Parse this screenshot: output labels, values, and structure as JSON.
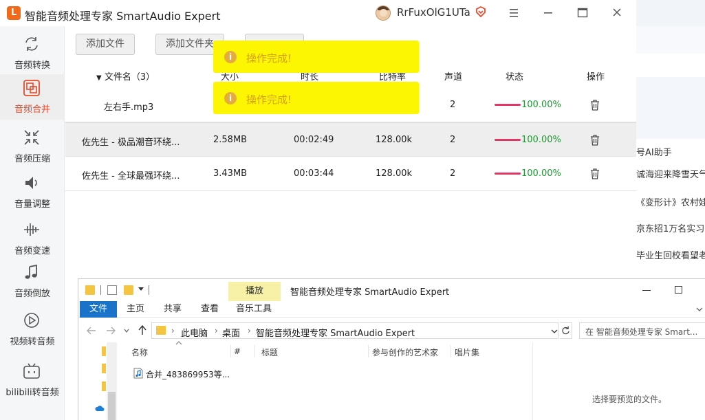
{
  "app": {
    "title": "智能音频处理专家 SmartAudio Expert",
    "logo_text": "L",
    "user_name": "RrFuxOlG1UTa",
    "accent_color": "#e8492a",
    "sidebar": [
      {
        "label": "音频转换",
        "icon": "convert-icon"
      },
      {
        "label": "音频合并",
        "icon": "merge-icon",
        "active": true
      },
      {
        "label": "音频压缩",
        "icon": "compress-icon"
      },
      {
        "label": "音量调整",
        "icon": "volume-icon"
      },
      {
        "label": "音频变速",
        "icon": "speed-icon"
      },
      {
        "label": "音频倒放",
        "icon": "reverse-icon"
      },
      {
        "label": "视频转音频",
        "icon": "video-to-audio-icon"
      },
      {
        "label": "bilibili转音频",
        "icon": "bilibili-icon"
      }
    ],
    "toolbar": {
      "add_file": "添加文件",
      "add_folder": "添加文件夹"
    },
    "table": {
      "headers": {
        "name": "文件名（3）",
        "size": "大小",
        "duration": "时长",
        "bitrate": "比特率",
        "channels": "声道",
        "status": "状态",
        "actions": "操作"
      },
      "rows": [
        {
          "name": "左右手.mp3",
          "size": "",
          "duration": "",
          "bitrate": "",
          "channels": "2",
          "progress": 1.0,
          "percent": "100.00%"
        },
        {
          "name": "佐先生 - 极品潮音环绕...",
          "size": "2.58MB",
          "duration": "00:02:49",
          "bitrate": "128.00k",
          "channels": "2",
          "progress": 1.0,
          "percent": "100.00%"
        },
        {
          "name": "佐先生 - 全球最强环绕...",
          "size": "3.43MB",
          "duration": "00:03:44",
          "bitrate": "128.00k",
          "channels": "2",
          "progress": 1.0,
          "percent": "100.00%"
        }
      ]
    },
    "toasts": [
      {
        "text": "操作完成!",
        "icon": "info-icon"
      },
      {
        "text": "操作完成!",
        "icon": "info-icon"
      }
    ],
    "toast_color": "#fdf603",
    "progress_color": "#e03766",
    "percent_color": "#1b9b2f"
  },
  "background_page": {
    "news": [
      "号AI助手",
      "诚海迎来降雪天气",
      "《变形计》农村娃",
      "京东招1万名实习",
      "毕业生回校看望老"
    ]
  },
  "explorer": {
    "title": "智能音频处理专家 SmartAudio Expert",
    "context_tab": "播放",
    "ribbon_tabs": [
      "文件",
      "主页",
      "共享",
      "查看",
      "音乐工具"
    ],
    "breadcrumbs": [
      "此电脑",
      "桌面",
      "智能音频处理专家 SmartAudio Expert"
    ],
    "search_placeholder": "在 智能音频处理专家 Smart...",
    "columns": [
      "名称",
      "#",
      "标题",
      "参与创作的艺术家",
      "唱片集"
    ],
    "files": [
      {
        "name": "合并_483869953等...",
        "icon": "audio-file-icon"
      }
    ],
    "preview_text": "选择要预览的文件。"
  }
}
